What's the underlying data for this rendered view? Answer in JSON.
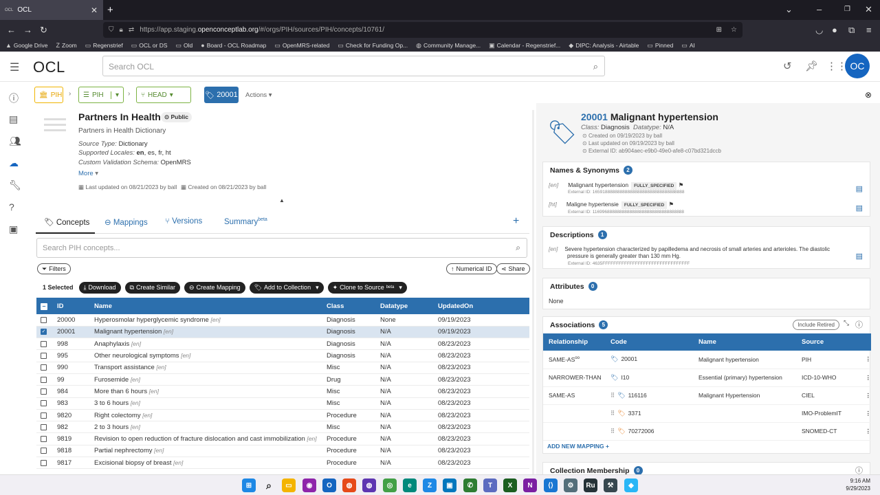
{
  "browser": {
    "tab_title": "OCL",
    "tab_favicon": "OCL",
    "url_prefix": "https://app.staging.",
    "url_domain": "openconceptlab.org",
    "url_path": "/#/orgs/PIH/sources/PIH/concepts/10761/",
    "bookmarks": [
      "Google Drive",
      "Zoom",
      "Regenstrief",
      "OCL or DS",
      "Old",
      "Board - OCL Roadmap",
      "OpenMRS-related",
      "Check for Funding Op...",
      "Community Manage...",
      "Calendar - Regenstrief...",
      "DIPC: Analysis - Airtable",
      "Pinned",
      "AI"
    ]
  },
  "header": {
    "logo": "OCL",
    "search_placeholder": "Search OCL",
    "avatar": "OC"
  },
  "breadcrumb": {
    "org": "PIH",
    "source": "PIH",
    "version": "HEAD",
    "concept": "20001",
    "actions": "Actions"
  },
  "source": {
    "title": "Partners In Health",
    "visibility": "Public",
    "full_name": "Partners in Health Dictionary",
    "source_type_label": "Source Type:",
    "source_type": "Dictionary",
    "locales_label": "Supported Locales:",
    "locale_default": "en",
    "locales_rest": ", es, fr, ht",
    "schema_label": "Custom Validation Schema:",
    "schema": "OpenMRS",
    "more": "More",
    "last_updated": "Last updated on 08/21/2023 by ball",
    "created": "Created on 08/21/2023 by ball"
  },
  "tabs": {
    "concepts": "Concepts",
    "mappings": "Mappings",
    "versions": "Versions",
    "summary": "Summary",
    "summary_sup": "beta"
  },
  "concepts_search_placeholder": "Search PIH concepts...",
  "toolbar": {
    "filters": "Filters",
    "numerical_id": "Numerical ID",
    "share": "Share",
    "selected": "1 Selected",
    "download": "Download",
    "create_similar": "Create Similar",
    "create_mapping": "Create Mapping",
    "add_to_collection": "Add to Collection",
    "clone_to_source": "Clone to Source",
    "clone_sup": "beta"
  },
  "table": {
    "headers": [
      "ID",
      "Name",
      "Class",
      "Datatype",
      "UpdatedOn"
    ],
    "rows": [
      {
        "id": "20000",
        "name": "Hyperosmolar hyperglycemic syndrome",
        "loc": "[en]",
        "cls": "Diagnosis",
        "dt": "None",
        "upd": "09/19/2023",
        "sel": false
      },
      {
        "id": "20001",
        "name": "Malignant hypertension",
        "loc": "[en]",
        "cls": "Diagnosis",
        "dt": "N/A",
        "upd": "09/19/2023",
        "sel": true
      },
      {
        "id": "998",
        "name": "Anaphylaxis",
        "loc": "[en]",
        "cls": "Diagnosis",
        "dt": "N/A",
        "upd": "08/23/2023",
        "sel": false
      },
      {
        "id": "995",
        "name": "Other neurological symptoms",
        "loc": "[en]",
        "cls": "Diagnosis",
        "dt": "N/A",
        "upd": "08/23/2023",
        "sel": false
      },
      {
        "id": "990",
        "name": "Transport assistance",
        "loc": "[en]",
        "cls": "Misc",
        "dt": "N/A",
        "upd": "08/23/2023",
        "sel": false
      },
      {
        "id": "99",
        "name": "Furosemide",
        "loc": "[en]",
        "cls": "Drug",
        "dt": "N/A",
        "upd": "08/23/2023",
        "sel": false
      },
      {
        "id": "984",
        "name": "More than 6 hours",
        "loc": "[en]",
        "cls": "Misc",
        "dt": "N/A",
        "upd": "08/23/2023",
        "sel": false
      },
      {
        "id": "983",
        "name": "3 to 6 hours",
        "loc": "[en]",
        "cls": "Misc",
        "dt": "N/A",
        "upd": "08/23/2023",
        "sel": false
      },
      {
        "id": "9820",
        "name": "Right colectomy",
        "loc": "[en]",
        "cls": "Procedure",
        "dt": "N/A",
        "upd": "08/23/2023",
        "sel": false
      },
      {
        "id": "982",
        "name": "2 to 3 hours",
        "loc": "[en]",
        "cls": "Misc",
        "dt": "N/A",
        "upd": "08/23/2023",
        "sel": false
      },
      {
        "id": "9819",
        "name": "Revision to open reduction of fracture dislocation and cast immobilization",
        "loc": "[en]",
        "cls": "Procedure",
        "dt": "N/A",
        "upd": "08/23/2023",
        "sel": false
      },
      {
        "id": "9818",
        "name": "Partial nephrectomy",
        "loc": "[en]",
        "cls": "Procedure",
        "dt": "N/A",
        "upd": "08/23/2023",
        "sel": false
      },
      {
        "id": "9817",
        "name": "Excisional biopsy of breast",
        "loc": "[en]",
        "cls": "Procedure",
        "dt": "N/A",
        "upd": "08/23/2023",
        "sel": false
      }
    ]
  },
  "concept": {
    "id": "20001",
    "name": "Malignant hypertension",
    "class_label": "Class:",
    "class": "Diagnosis",
    "datatype_label": "Datatype:",
    "datatype": "N/A",
    "created": "Created on 09/19/2023 by ball",
    "updated": "Last updated on 09/19/2023 by ball",
    "external_id": "External ID: ab904aec-e9b0-49e0-afe8-c07bd321dccb"
  },
  "names": {
    "title": "Names & Synonyms",
    "count": "2",
    "items": [
      {
        "loc": "[en]",
        "name": "Malignant hypertension",
        "type": "FULLY_SPECIFIED",
        "ext": "External ID: 1659188888888888888888888888888888888"
      },
      {
        "loc": "[ht]",
        "name": "Maligne hypertensie",
        "type": "FULLY_SPECIFIED",
        "ext": "External ID: 1169968888888888888888888888888888888"
      }
    ]
  },
  "descriptions": {
    "title": "Descriptions",
    "count": "1",
    "loc": "[en]",
    "text1": "Severe hypertension characterized by papilledema and necrosis of small arteries and arterioles. The diastolic",
    "text2": "pressure is generally greater than 130 mm Hg.",
    "ext": "External ID: 4635FFFFFFFFFFFFFFFFFFFFFFFFFFFFFFFF"
  },
  "attributes": {
    "title": "Attributes",
    "count": "0",
    "value": "None"
  },
  "associations": {
    "title": "Associations",
    "count": "5",
    "include_retired": "Include Retired",
    "headers": [
      "Relationship",
      "Code",
      "Name",
      "Source"
    ],
    "rows": [
      {
        "rel": "SAME-AS",
        "sup": "oo",
        "code": "20001",
        "name": "Malignant hypertension",
        "source": "PIH",
        "color": "b"
      },
      {
        "rel": "NARROWER-THAN",
        "sup": "",
        "code": "I10",
        "name": "Essential (primary) hypertension",
        "source": "ICD-10-WHO",
        "color": "b"
      },
      {
        "rel": "SAME-AS",
        "sup": "",
        "code": "116116",
        "name": "Malignant Hypertension",
        "source": "CIEL",
        "color": "b"
      },
      {
        "rel": "",
        "sup": "",
        "code": "3371",
        "name": "",
        "source": "IMO-ProblemIT",
        "color": "o"
      },
      {
        "rel": "",
        "sup": "",
        "code": "70272006",
        "name": "",
        "source": "SNOMED-CT",
        "color": "o"
      }
    ],
    "add_new": "ADD NEW MAPPING"
  },
  "collection": {
    "title": "Collection Membership",
    "count": "0"
  },
  "clock": {
    "time": "9:16 AM",
    "date": "9/29/2023"
  },
  "colors": {
    "primary": "#2c6fad",
    "org": "#f0b400",
    "source": "#7cb342"
  }
}
